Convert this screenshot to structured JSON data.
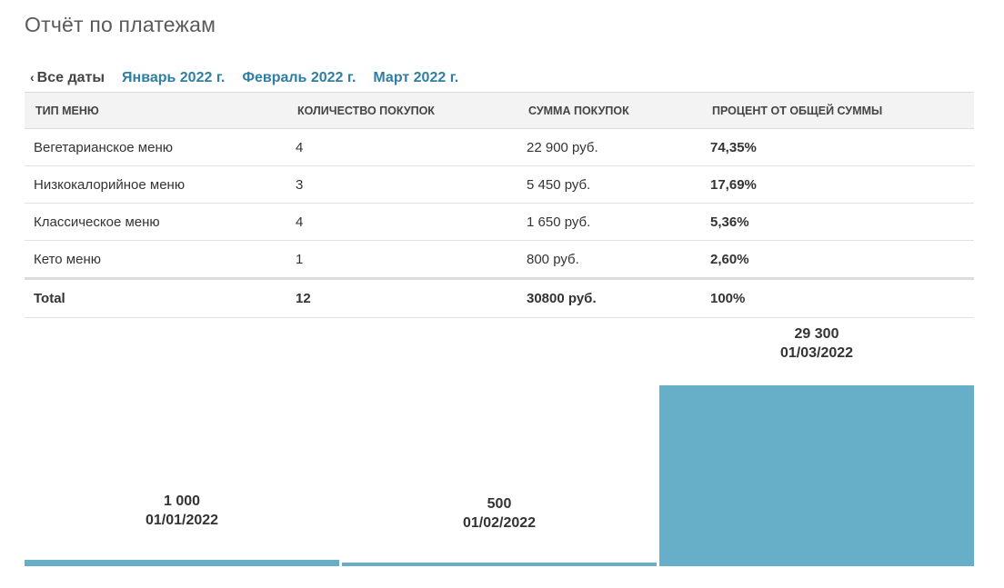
{
  "page": {
    "title": "Отчёт по платежам"
  },
  "date_nav": {
    "all_dates": "Все даты",
    "months": [
      "Январь 2022 г.",
      "Февраль 2022 г.",
      "Март 2022 г."
    ]
  },
  "table": {
    "headers": [
      "ТИП МЕНЮ",
      "КОЛИЧЕСТВО ПОКУПОК",
      "СУММА ПОКУПОК",
      "ПРОЦЕНТ ОТ ОБЩЕЙ СУММЫ"
    ],
    "rows": [
      [
        "Вегетарианское меню",
        "4",
        "22 900 руб.",
        "74,35%"
      ],
      [
        "Низкокалорийное меню",
        "3",
        "5 450 руб.",
        "17,69%"
      ],
      [
        "Классическое меню",
        "4",
        "1 650 руб.",
        "5,36%"
      ],
      [
        "Кето меню",
        "1",
        "800 руб.",
        "2,60%"
      ]
    ],
    "total": [
      "Total",
      "12",
      "30800 руб.",
      "100%"
    ]
  },
  "chart_data": {
    "type": "bar",
    "categories": [
      "01/01/2022",
      "01/02/2022",
      "01/03/2022"
    ],
    "values": [
      1000,
      500,
      29300
    ],
    "value_labels": [
      "1 000",
      "500",
      "29 300"
    ],
    "title": "",
    "xlabel": "",
    "ylabel": "",
    "color": "#67aec9"
  }
}
